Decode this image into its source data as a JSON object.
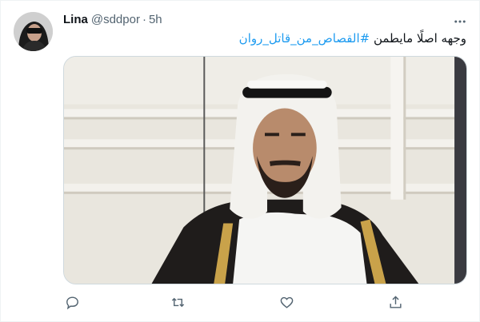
{
  "tweet": {
    "display_name": "Lina",
    "handle": "@sddpor",
    "separator": "·",
    "time": "5h",
    "text_plain": "وجهه اصلًا مايطمن ",
    "hashtag": "#القصاص_من_قاتل_روان"
  },
  "icons": {
    "more": "more-horizontal-icon",
    "reply": "reply-icon",
    "retweet": "retweet-icon",
    "like": "heart-icon",
    "share": "share-icon"
  },
  "colors": {
    "text": "#0f1419",
    "secondary": "#536471",
    "link": "#1d9bf0",
    "border": "#cfd9de"
  }
}
